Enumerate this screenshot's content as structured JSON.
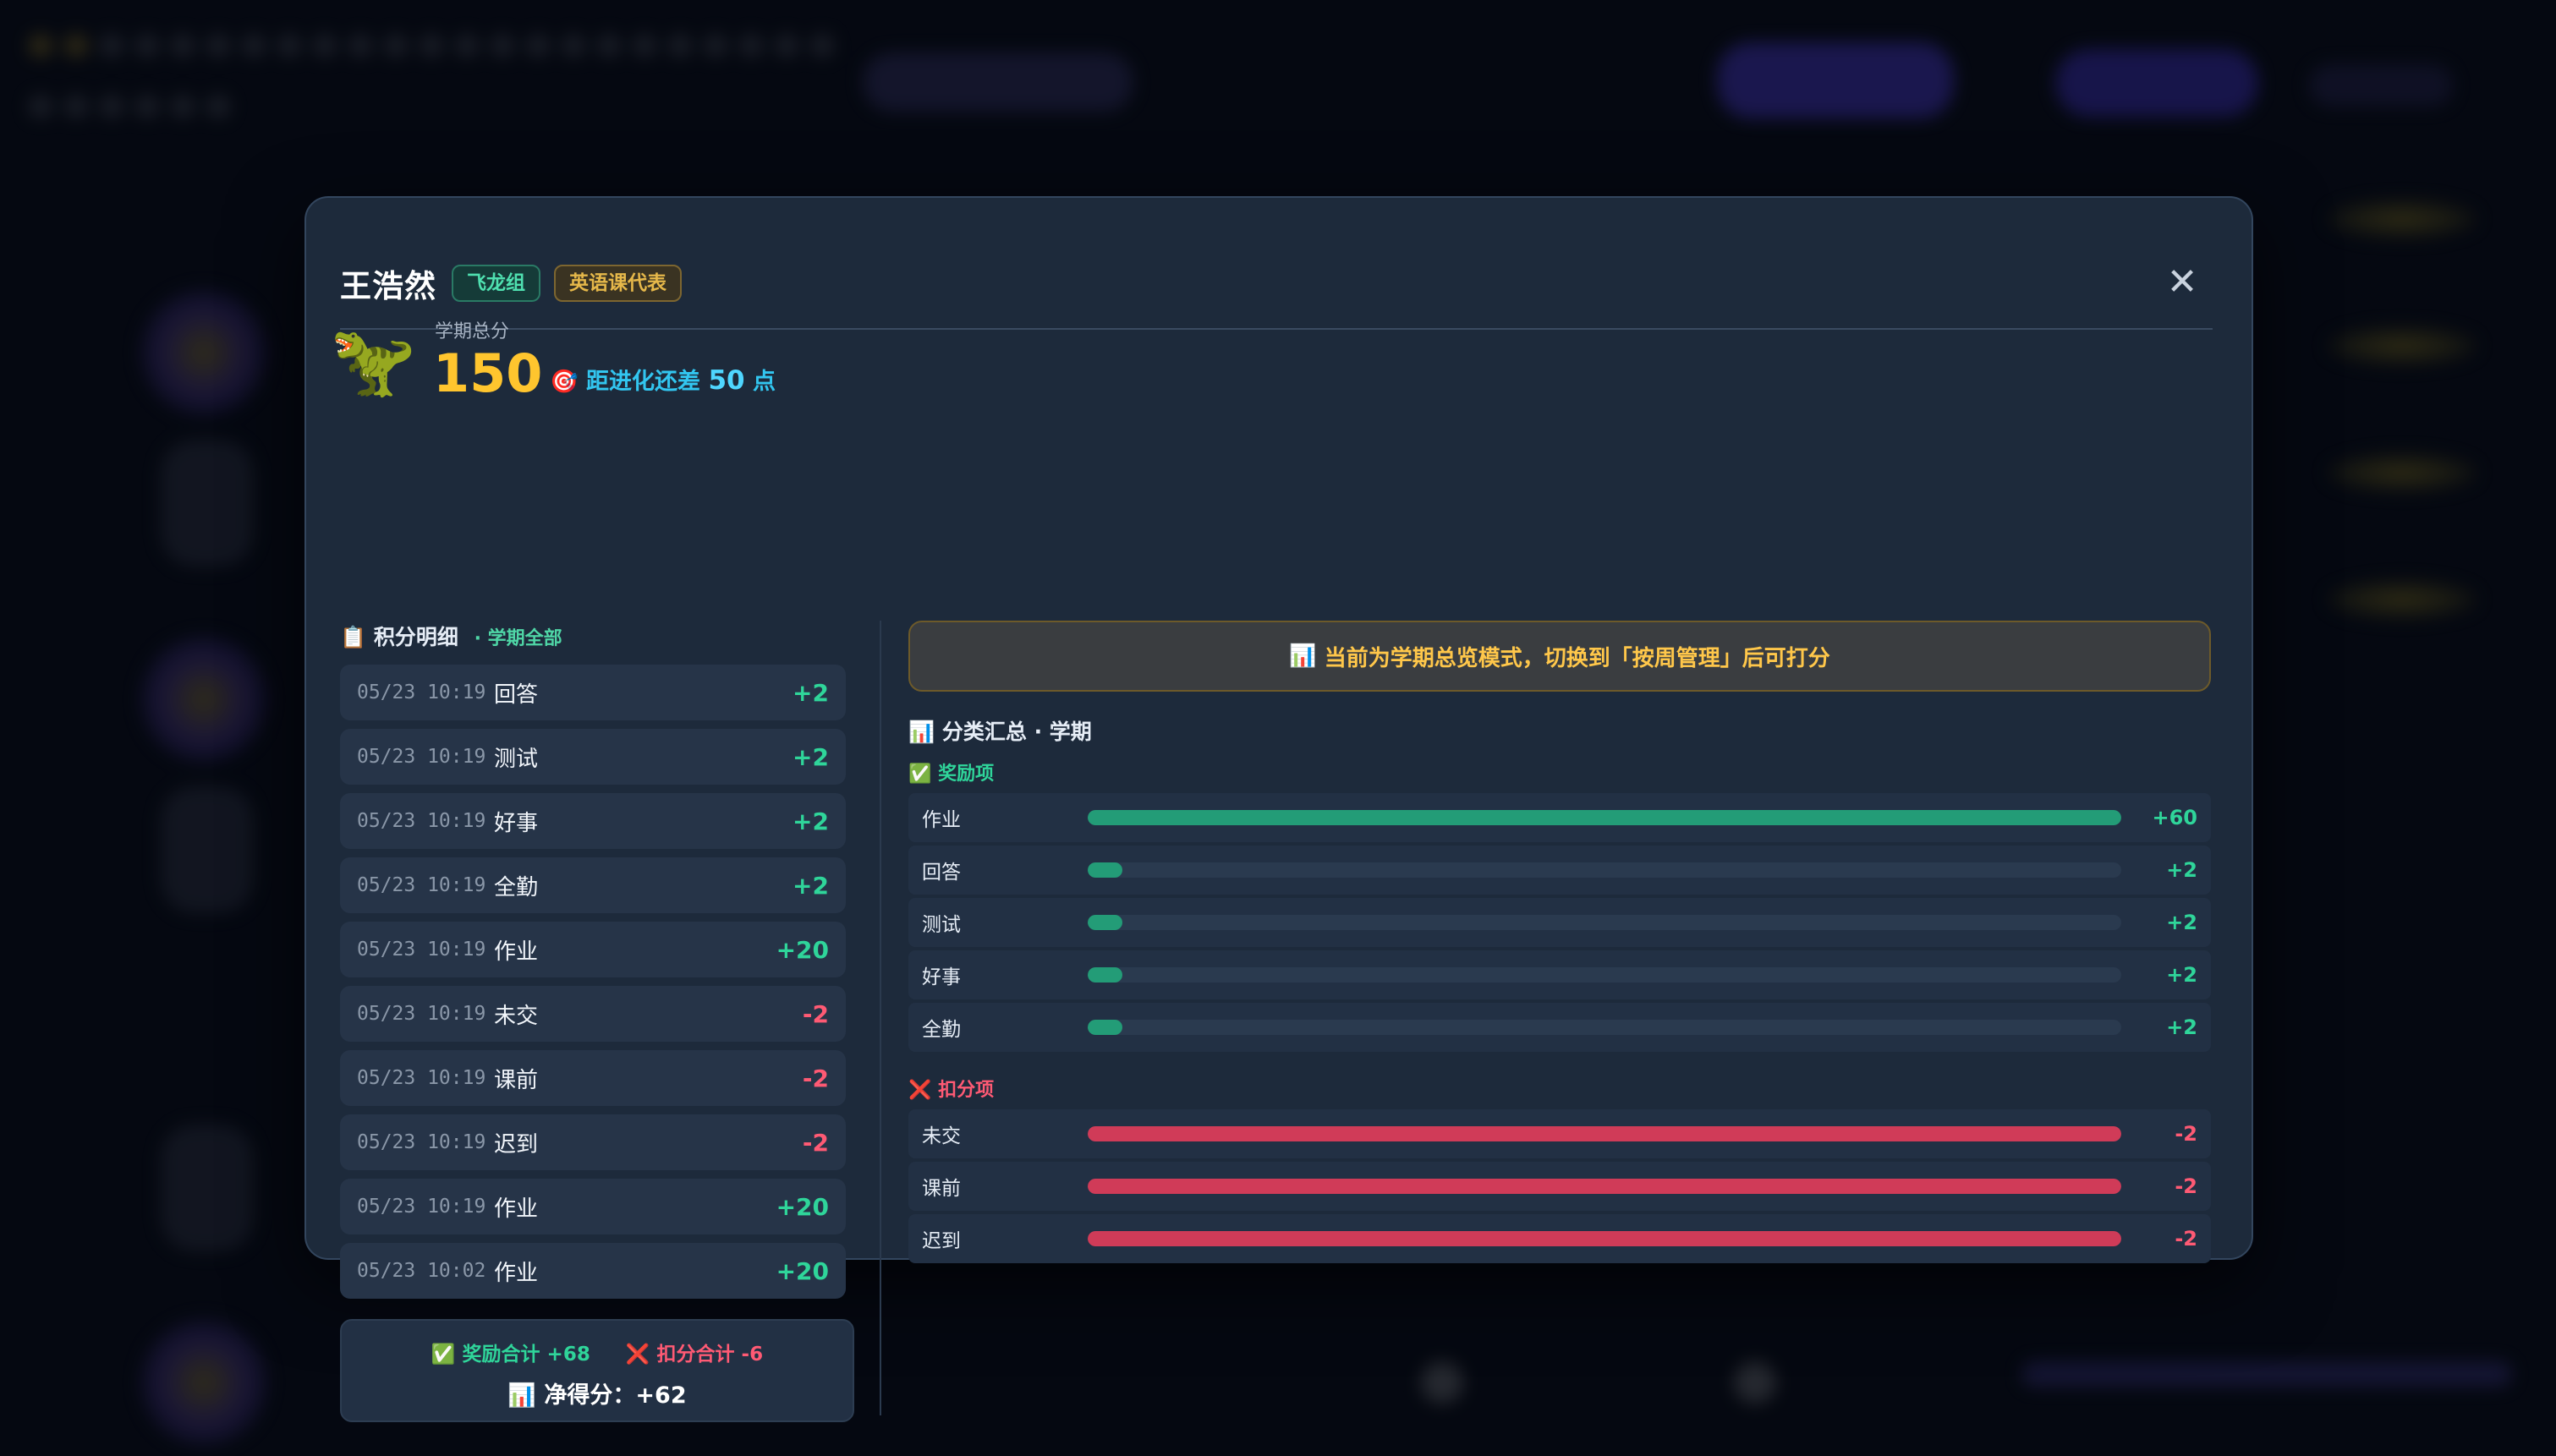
{
  "student": {
    "name": "王浩然",
    "group_tag": "飞龙组",
    "role_tag": "英语课代表"
  },
  "close_icon": "✕",
  "score": {
    "avatar_icon": "🦖",
    "label": "学期总分",
    "value": "150",
    "evolve_icon": "🎯",
    "evolve_prefix": "距进化还差",
    "evolve_points": "50",
    "evolve_suffix": "点"
  },
  "records": {
    "title_icon": "📋",
    "title": "积分明细",
    "subtitle": "· 学期全部",
    "items": [
      {
        "time": "05/23 10:19",
        "type": "回答",
        "points": "+2",
        "sign": "pos"
      },
      {
        "time": "05/23 10:19",
        "type": "测试",
        "points": "+2",
        "sign": "pos"
      },
      {
        "time": "05/23 10:19",
        "type": "好事",
        "points": "+2",
        "sign": "pos"
      },
      {
        "time": "05/23 10:19",
        "type": "全勤",
        "points": "+2",
        "sign": "pos"
      },
      {
        "time": "05/23 10:19",
        "type": "作业",
        "points": "+20",
        "sign": "pos"
      },
      {
        "time": "05/23 10:19",
        "type": "未交",
        "points": "-2",
        "sign": "neg"
      },
      {
        "time": "05/23 10:19",
        "type": "课前",
        "points": "-2",
        "sign": "neg"
      },
      {
        "time": "05/23 10:19",
        "type": "迟到",
        "points": "-2",
        "sign": "neg"
      },
      {
        "time": "05/23 10:19",
        "type": "作业",
        "points": "+20",
        "sign": "pos"
      },
      {
        "time": "05/23 10:02",
        "type": "作业",
        "points": "+20",
        "sign": "pos"
      }
    ],
    "summary": {
      "reward_icon": "✅",
      "reward_text": "奖励合计 +68",
      "deduct_icon": "❌",
      "deduct_text": "扣分合计 -6",
      "net_icon": "📊",
      "net_text": "净得分：+62"
    }
  },
  "notice": {
    "icon": "📊",
    "text": "当前为学期总览模式，切换到「按周管理」后可打分"
  },
  "category_summary": {
    "title_icon": "📊",
    "title": "分类汇总 · 学期",
    "reward_icon": "✅",
    "reward_label": "奖励项",
    "rewards": [
      {
        "label": "作业",
        "value": "+60",
        "fraction": 1.0
      },
      {
        "label": "回答",
        "value": "+2",
        "fraction": 0.0333
      },
      {
        "label": "测试",
        "value": "+2",
        "fraction": 0.0333
      },
      {
        "label": "好事",
        "value": "+2",
        "fraction": 0.0333
      },
      {
        "label": "全勤",
        "value": "+2",
        "fraction": 0.0333
      }
    ],
    "deduct_icon": "❌",
    "deduct_label": "扣分项",
    "deductions": [
      {
        "label": "未交",
        "value": "-2",
        "fraction": 1.0
      },
      {
        "label": "课前",
        "value": "-2",
        "fraction": 1.0
      },
      {
        "label": "迟到",
        "value": "-2",
        "fraction": 1.0
      }
    ]
  },
  "colors": {
    "accent_gold": "#ffc52e",
    "positive": "#2fd59a",
    "negative": "#ff5a74",
    "info": "#32c6f0"
  }
}
